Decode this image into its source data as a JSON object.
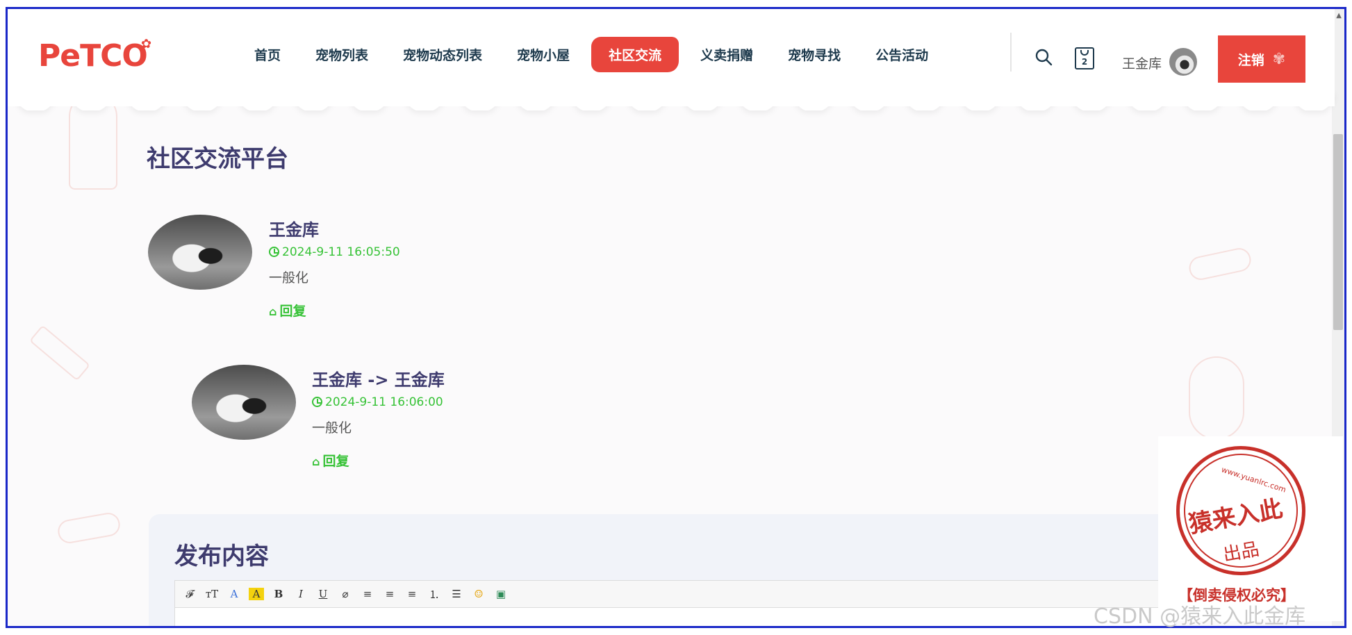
{
  "header": {
    "logo": "PeTCO",
    "nav": [
      {
        "label": "首页",
        "active": false
      },
      {
        "label": "宠物列表",
        "active": false
      },
      {
        "label": "宠物动态列表",
        "active": false
      },
      {
        "label": "宠物小屋",
        "active": false
      },
      {
        "label": "社区交流",
        "active": true
      },
      {
        "label": "义卖捐赠",
        "active": false
      },
      {
        "label": "宠物寻找",
        "active": false
      },
      {
        "label": "公告活动",
        "active": false
      }
    ],
    "cart_count": "2",
    "user_name": "王金库",
    "logout_label": "注销"
  },
  "page": {
    "title": "社区交流平台"
  },
  "comments": [
    {
      "author": "王金库",
      "time": "2024-9-11 16:05:50",
      "text": "一般化",
      "reply_label": "回复"
    },
    {
      "author": "王金库 -> 王金库",
      "time": "2024-9-11 16:06:00",
      "text": "一般化",
      "reply_label": "回复"
    }
  ],
  "publish": {
    "title": "发布内容",
    "toolbar": [
      "𝓕",
      "тT",
      "A",
      "A",
      "B",
      "I",
      "U",
      "⌀",
      "≡",
      "≡",
      "≡",
      "⒈",
      "☰",
      "☺",
      "▣"
    ]
  },
  "watermark": {
    "stamp_url": "www.yuanlrc.com",
    "stamp_main": "猿来入此",
    "stamp_sub": "出品",
    "stamp_warning": "【倒卖侵权必究】",
    "csdn": "CSDN @猿来入此金库"
  },
  "colors": {
    "accent": "#e8453c",
    "heading": "#3e3b6e",
    "time_green": "#36c236",
    "nav_text": "#1e3a4d"
  }
}
